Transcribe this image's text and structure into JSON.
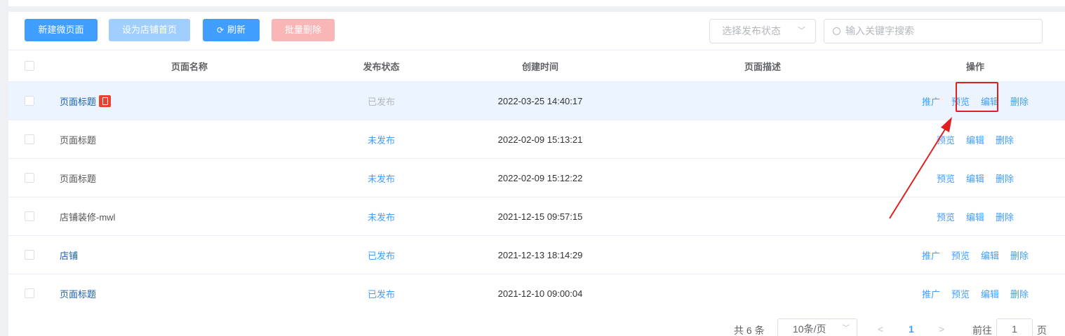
{
  "toolbar": {
    "new_page": "新建微页面",
    "set_home": "设为店铺首页",
    "refresh": "刷新",
    "batch_delete": "批量删除",
    "refresh_icon": "refresh-icon",
    "status_select_placeholder": "选择发布状态",
    "search_placeholder": "输入关键字搜索"
  },
  "table": {
    "headers": {
      "name": "页面名称",
      "status": "发布状态",
      "created": "创建时间",
      "description": "页面描述",
      "actions": "操作"
    },
    "rows": [
      {
        "name": "页面标题",
        "status": "已发布",
        "created": "2022-03-25 14:40:17",
        "ops": [
          "推广",
          "预览",
          "编辑",
          "删除"
        ],
        "has_badge": true
      },
      {
        "name": "页面标题",
        "status": "未发布",
        "created": "2022-02-09 15:13:21",
        "ops": [
          "预览",
          "编辑",
          "删除"
        ]
      },
      {
        "name": "页面标题",
        "status": "未发布",
        "created": "2022-02-09 15:12:22",
        "ops": [
          "预览",
          "编辑",
          "删除"
        ]
      },
      {
        "name": "店铺装修-mwl",
        "status": "未发布",
        "created": "2021-12-15 09:57:15",
        "ops": [
          "预览",
          "编辑",
          "删除"
        ]
      },
      {
        "name": "店铺",
        "status": "已发布",
        "created": "2021-12-13 18:14:29",
        "ops": [
          "推广",
          "预览",
          "编辑",
          "删除"
        ]
      },
      {
        "name": "页面标题",
        "status": "已发布",
        "created": "2021-12-10 09:00:04",
        "ops": [
          "推广",
          "预览",
          "编辑",
          "删除"
        ]
      }
    ]
  },
  "pagination": {
    "total": "共 6 条",
    "page_size": "10条/页",
    "current_page": "1",
    "goto_label": "前往",
    "goto_value": "1",
    "page_unit": "页"
  },
  "colors": {
    "primary": "#409eff",
    "danger_light": "#fab6b6",
    "highlight_row": "#ecf5ff",
    "annotation": "#e02020"
  }
}
